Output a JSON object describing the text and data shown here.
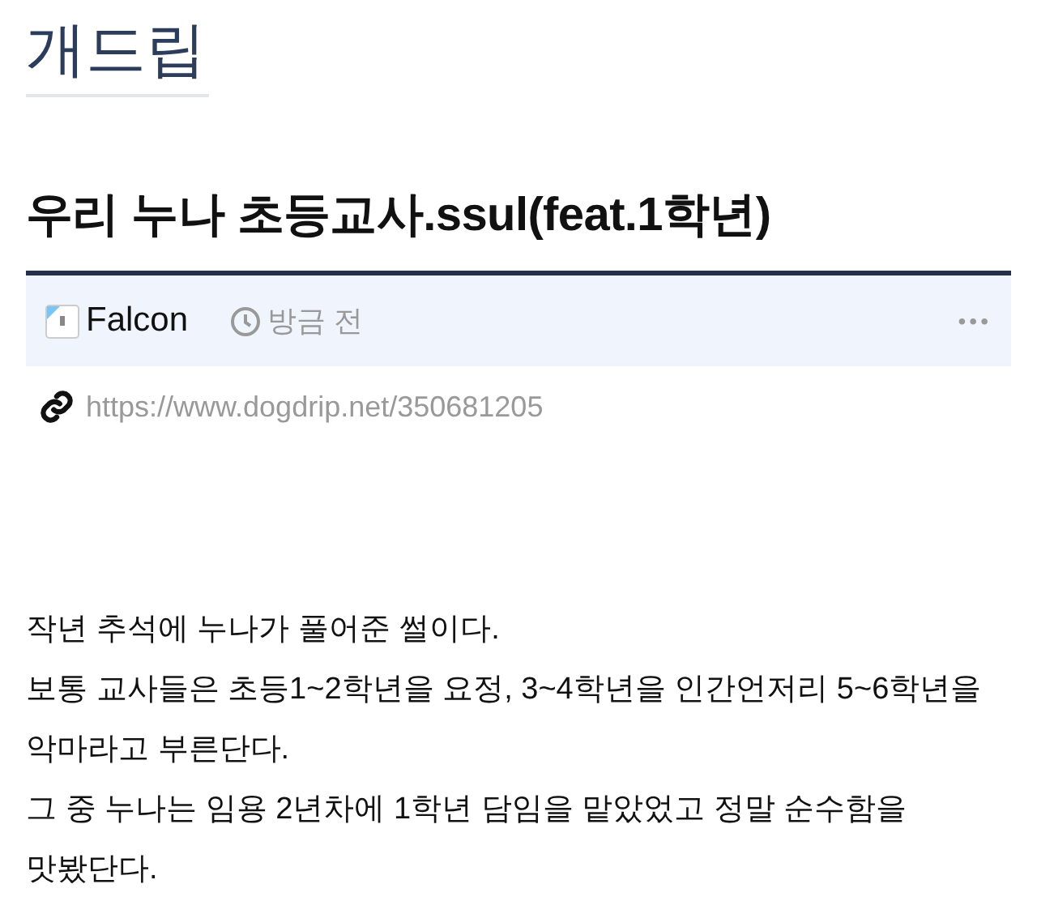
{
  "site": {
    "logo": "개드립"
  },
  "post": {
    "title": "우리 누나 초등교사.ssul(feat.1학년)",
    "author": "Falcon",
    "time": "방금 전",
    "menu": "•••",
    "url": "https://www.dogdrip.net/350681205",
    "paragraphs": [
      "작년 추석에 누나가 풀어준 썰이다.",
      "보통 교사들은 초등1~2학년을 요정, 3~4학년을 인간언저리 5~6학년을 악마라고 부른단다.",
      "그 중 누나는 임용 2년차에 1학년 담임을 맡았었고 정말 순수함을 맛봤단다."
    ]
  }
}
